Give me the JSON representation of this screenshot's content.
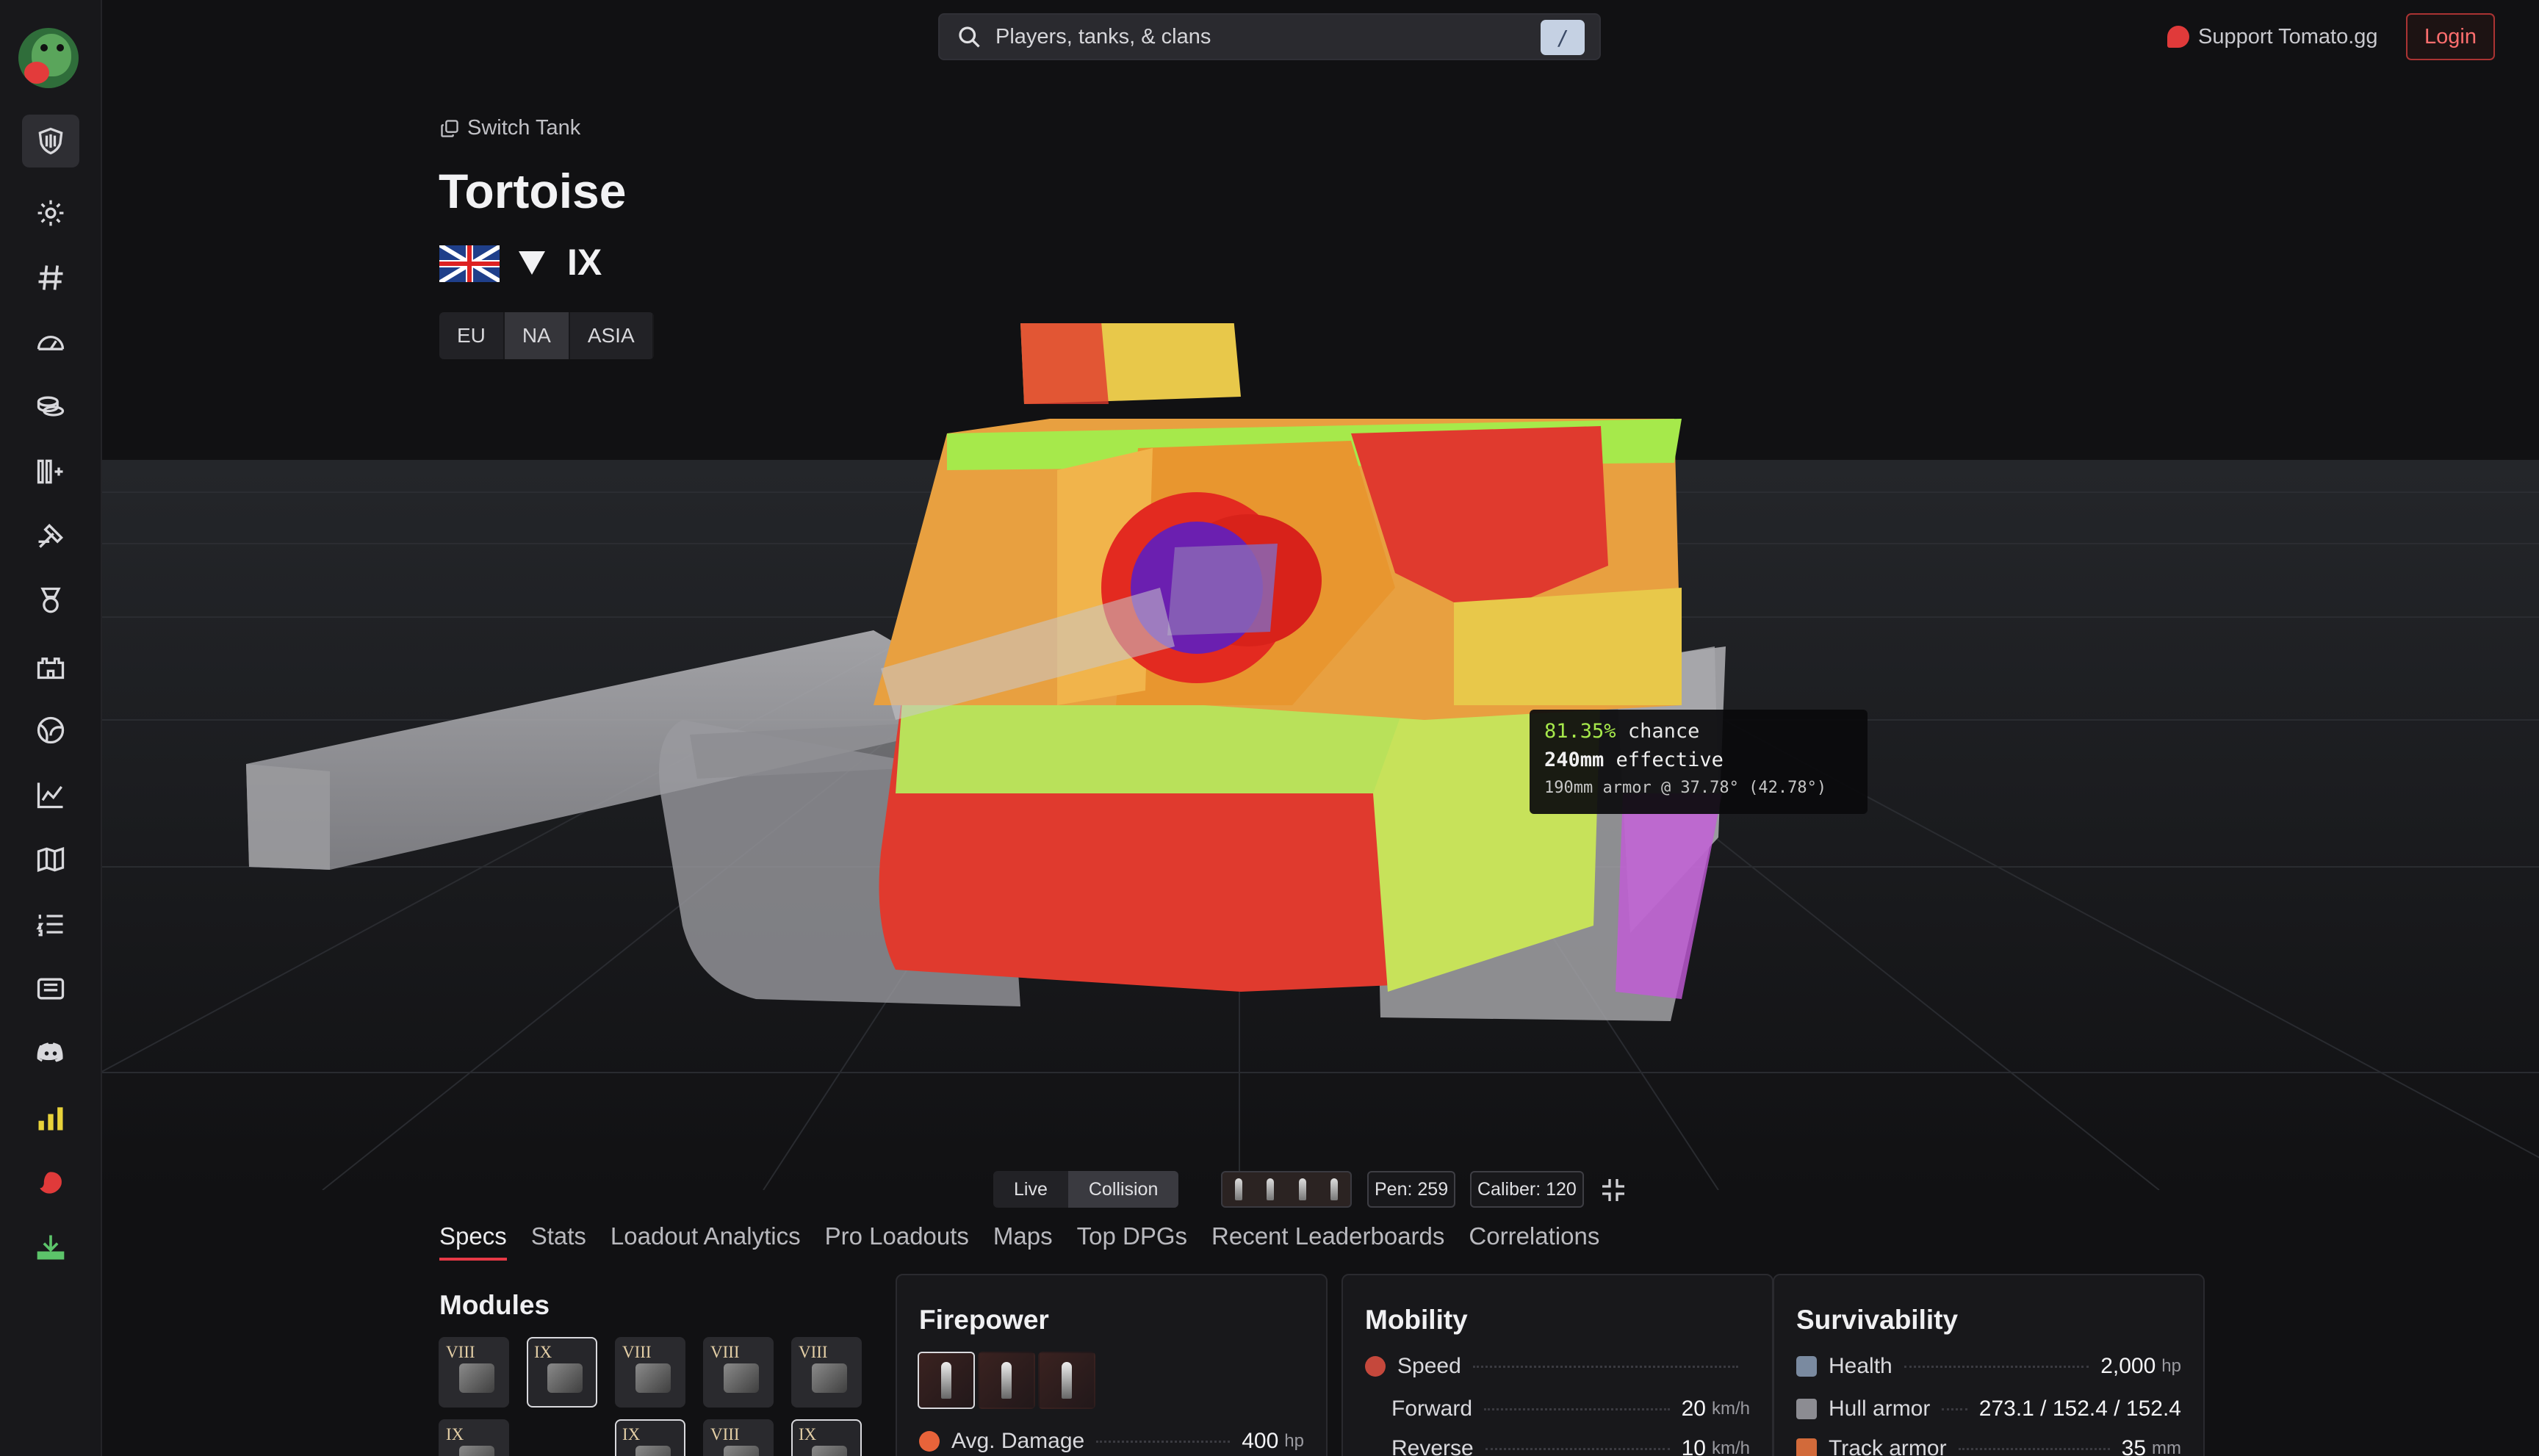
{
  "search": {
    "placeholder": "Players, tanks, & clans",
    "shortcut": "/"
  },
  "header_actions": {
    "support": "Support Tomato.gg",
    "login": "Login"
  },
  "tank": {
    "switch_label": "Switch Tank",
    "name": "Tortoise",
    "tier": "IX",
    "nation_icon": "uk-flag",
    "type_icon": "tank-destroyer-icon"
  },
  "regions": [
    "EU",
    "NA",
    "ASIA"
  ],
  "regions_active": "NA",
  "tooltip": {
    "chance": "81.35%",
    "chance_word": "chance",
    "effective": "240mm",
    "effective_word": "effective",
    "detail": "190mm armor @ 37.78° (42.78°)"
  },
  "viewer_controls": {
    "mode_live": "Live",
    "mode_collision": "Collision",
    "mode_active": "Collision",
    "pen_label": "Pen:",
    "pen_value": "259",
    "caliber_label": "Caliber:",
    "caliber_value": "120"
  },
  "tabs": [
    "Specs",
    "Stats",
    "Loadout Analytics",
    "Pro Loadouts",
    "Maps",
    "Top DPGs",
    "Recent Leaderboards",
    "Correlations"
  ],
  "tabs_active": "Specs",
  "modules": {
    "title": "Modules",
    "row1_tiers": [
      "VIII",
      "IX",
      "VIII",
      "VIII",
      "VIII"
    ],
    "row2_tiers": [
      "IX",
      "IX",
      "VIII",
      "IX"
    ]
  },
  "firepower": {
    "title": "Firepower",
    "avg_damage_label": "Avg. Damage",
    "avg_damage_value": "400",
    "avg_damage_unit": "hp"
  },
  "mobility": {
    "title": "Mobility",
    "speed_label": "Speed",
    "forward_label": "Forward",
    "forward_value": "20",
    "forward_unit": "km/h",
    "reverse_label": "Reverse",
    "reverse_value": "10",
    "reverse_unit": "km/h"
  },
  "survivability": {
    "title": "Survivability",
    "health_label": "Health",
    "health_value": "2,000",
    "health_unit": "hp",
    "hull_label": "Hull armor",
    "hull_value": "273.1 / 152.4 / 152.4",
    "track_label": "Track armor",
    "track_value": "35",
    "track_unit": "mm"
  },
  "colors": {
    "accent": "#e63946",
    "armor_weak": "#a6e94b",
    "armor_mid": "#e8c84a",
    "armor_strong": "#e03a2e",
    "armor_gun": "#6b1fb0"
  }
}
